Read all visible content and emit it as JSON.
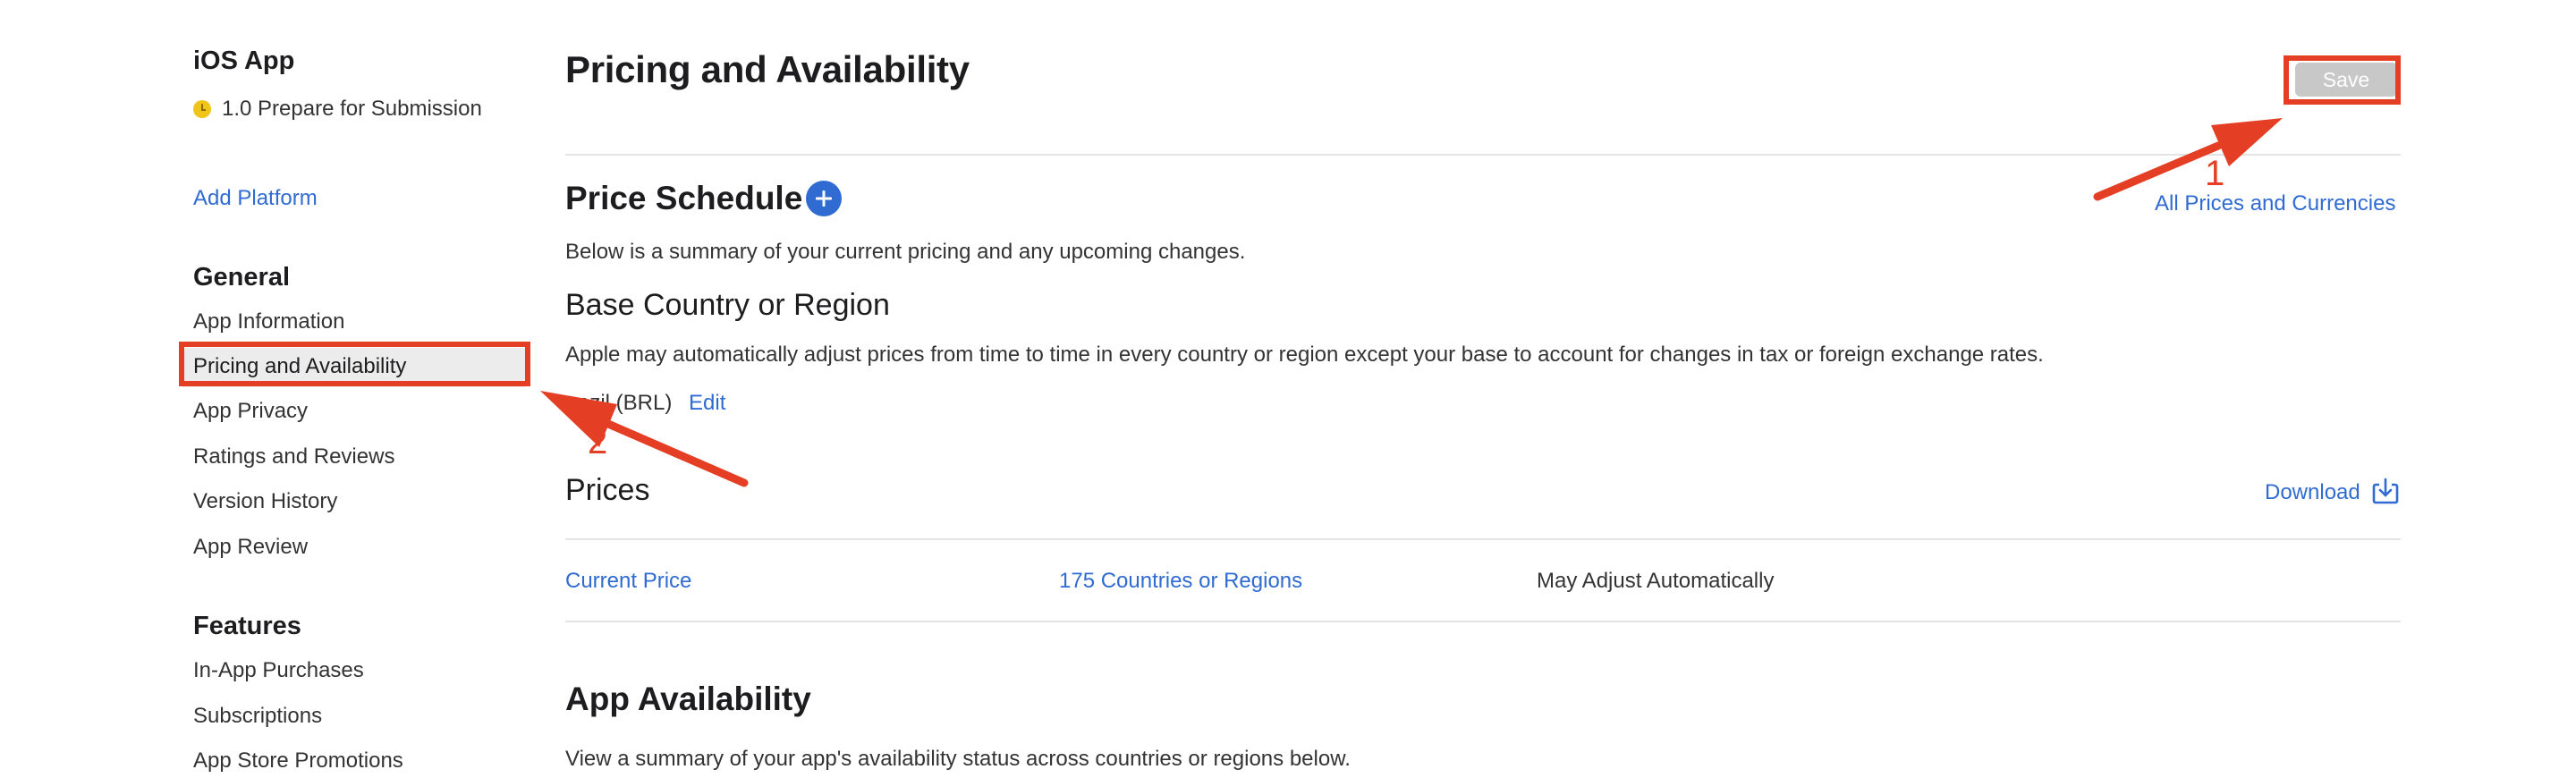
{
  "sidebar": {
    "app_title": "iOS App",
    "status": "1.0 Prepare for Submission",
    "add_platform": "Add Platform",
    "general_heading": "General",
    "general_items": [
      {
        "label": "App Information"
      },
      {
        "label": "Pricing and Availability",
        "active": true
      },
      {
        "label": "App Privacy"
      },
      {
        "label": "Ratings and Reviews"
      },
      {
        "label": "Version History"
      },
      {
        "label": "App Review"
      }
    ],
    "features_heading": "Features",
    "features_items": [
      {
        "label": "In-App Purchases"
      },
      {
        "label": "Subscriptions"
      },
      {
        "label": "App Store Promotions"
      }
    ]
  },
  "header": {
    "title": "Pricing and Availability",
    "save_label": "Save"
  },
  "price_schedule": {
    "heading": "Price Schedule",
    "all_prices_link": "All Prices and Currencies",
    "summary": "Below is a summary of your current pricing and any upcoming changes.",
    "base_heading": "Base Country or Region",
    "base_description": "Apple may automatically adjust prices from time to time in every country or region except your base to account for changes in tax or foreign exchange rates.",
    "base_value": "razil (BRL)",
    "edit_label": "Edit"
  },
  "prices": {
    "heading": "Prices",
    "download_label": "Download",
    "row": {
      "current_price": "Current Price",
      "countries": "175 Countries or Regions",
      "adjust": "May Adjust Automatically"
    }
  },
  "availability": {
    "heading": "App Availability",
    "description": "View a summary of your app's availability status across countries or regions below."
  },
  "annotations": {
    "label_1": "1",
    "label_2": "2",
    "color": "#e43f24"
  },
  "colors": {
    "link": "#2f6bd1",
    "status_dot": "#f0c419",
    "save_disabled": "#c8c8c8"
  },
  "icons": [
    "status-dot-icon",
    "plus-circle-icon",
    "download-icon"
  ]
}
